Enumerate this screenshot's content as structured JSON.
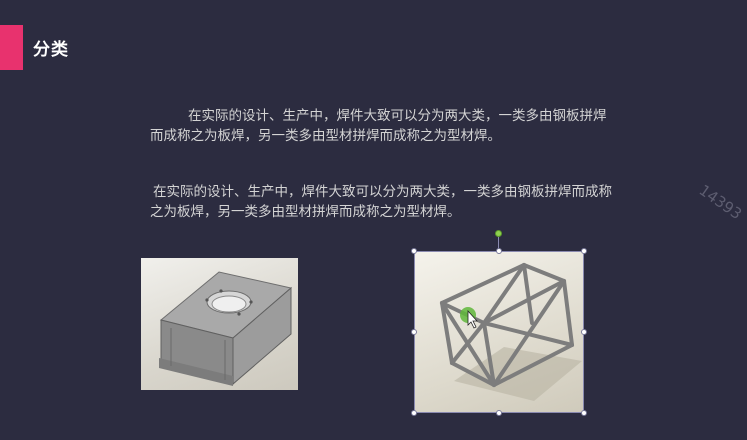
{
  "slide": {
    "title": "分类",
    "paragraph1": "在实际的设计、生产中，焊件大致可以分为两大类，一类多由钢板拼焊而成称之为板焊，另一类多由型材拼焊而成称之为型材焊。",
    "paragraph2": "在实际的设计、生产中，焊件大致可以分为两大类，一类多由钢板拼焊而成称之为板焊，另一类多由型材拼焊而成称之为型材焊。",
    "watermark": "14393"
  },
  "colors": {
    "background": "#2c2c40",
    "accent": "#e8326e",
    "text": "#d4d4d4",
    "selection_handle": "#8fd14f"
  },
  "icons": {
    "cursor": "move-cursor-icon"
  }
}
